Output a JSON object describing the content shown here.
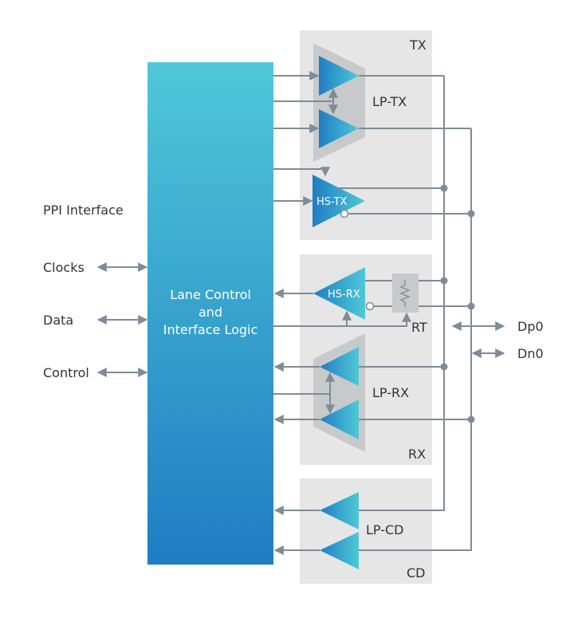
{
  "left": {
    "ppi_label": "PPI Interface",
    "signals": [
      "Clocks",
      "Data",
      "Control"
    ]
  },
  "core": {
    "lines": [
      "Lane Control",
      "and",
      "Interface Logic"
    ]
  },
  "tx": {
    "label": "TX",
    "lp_label": "LP-TX",
    "hs_label": "HS-TX"
  },
  "rx": {
    "label": "RX",
    "lp_label": "LP-RX",
    "hs_label": "HS-RX",
    "rt_label": "RT"
  },
  "cd": {
    "label": "CD",
    "lp_label": "LP-CD"
  },
  "pins": [
    "Dp0",
    "Dn0"
  ],
  "colors": {
    "gradient_top": "#4fc8d8",
    "gradient_bottom": "#1f7dc3",
    "wire": "#7d8c96",
    "box": "#e6e6e6",
    "mux": "#c8c9cb"
  }
}
